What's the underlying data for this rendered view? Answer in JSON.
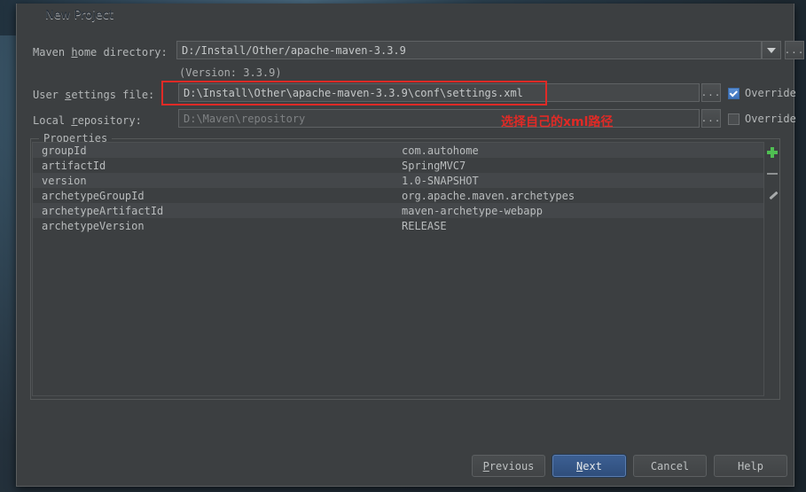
{
  "window": {
    "title": "New Project",
    "app_icon": "intellij-idea-logo-icon",
    "close_label": "✕"
  },
  "form": {
    "maven_home": {
      "label_prefix": "Maven ",
      "label_accel": "h",
      "label_suffix": "ome directory:",
      "label_full": "Maven home directory:",
      "value": "D:/Install/Other/apache-maven-3.3.9",
      "dropdown_icon": "chevron-down-icon",
      "browse_label": "..."
    },
    "version_note": "(Version: 3.3.9)",
    "user_settings": {
      "label_prefix": "User ",
      "label_accel": "s",
      "label_suffix": "ettings file:",
      "label_full": "User settings file:",
      "value": "D:\\Install\\Other\\apache-maven-3.3.9\\conf\\settings.xml",
      "browse_label": "...",
      "override_label": "Override",
      "override_checked": true
    },
    "local_repository": {
      "label_prefix": "Local ",
      "label_accel": "r",
      "label_suffix": "epository:",
      "label_full": "Local repository:",
      "value": "D:\\Maven\\repository",
      "browse_label": "...",
      "override_label": "Override",
      "override_checked": false
    }
  },
  "annotation": {
    "text": "选择自己的xml路径",
    "color": "#e02a26"
  },
  "properties": {
    "legend": "Properties",
    "rows": [
      {
        "key": "groupId",
        "value": "com.autohome"
      },
      {
        "key": "artifactId",
        "value": "SpringMVC7"
      },
      {
        "key": "version",
        "value": "1.0-SNAPSHOT"
      },
      {
        "key": "archetypeGroupId",
        "value": "org.apache.maven.archetypes"
      },
      {
        "key": "archetypeArtifactId",
        "value": "maven-archetype-webapp"
      },
      {
        "key": "archetypeVersion",
        "value": "RELEASE"
      }
    ],
    "tools": {
      "add": "add-property-icon",
      "remove": "remove-property-icon",
      "edit": "edit-property-icon"
    }
  },
  "footer": {
    "previous": {
      "prefix": "",
      "accel": "P",
      "suffix": "revious",
      "full": "Previous"
    },
    "next": {
      "prefix": "",
      "accel": "N",
      "suffix": "ext",
      "full": "Next"
    },
    "cancel": {
      "full": "Cancel"
    },
    "help": {
      "full": "Help"
    }
  },
  "colors": {
    "accent": "#3c5f92",
    "panel": "#3c3f41",
    "annotation": "#e02a26",
    "add_green": "#4fbf52"
  }
}
